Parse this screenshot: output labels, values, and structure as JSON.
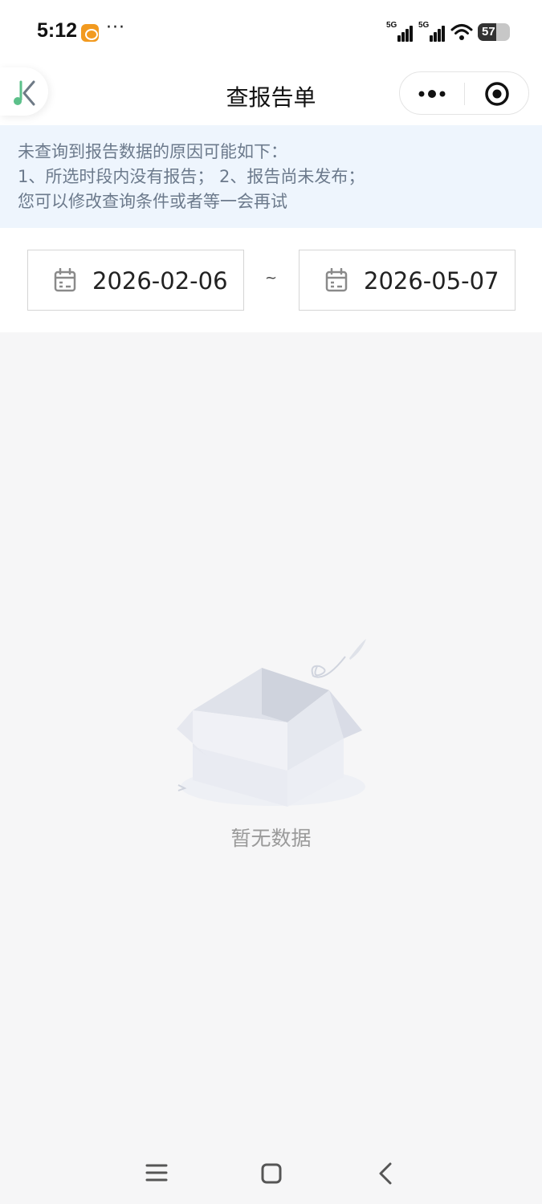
{
  "status": {
    "time": "5:12",
    "more": "···",
    "network_1": "5G",
    "network_2": "5G",
    "battery": "57"
  },
  "nav": {
    "title": "查报告单",
    "more_icon": "more-dots-icon",
    "close_icon": "target-close-icon",
    "back_icon": "back-logo-icon"
  },
  "notice": {
    "line1": "未查询到报告数据的原因可能如下：",
    "line2": "1、所选时段内没有报告； 2、报告尚未发布；",
    "line3": "您可以修改查询条件或者等一会再试"
  },
  "date_range": {
    "start": "2026-02-06",
    "separator": "~",
    "end": "2026-05-07",
    "icon": "calendar-icon"
  },
  "empty_state": {
    "text": "暂无数据",
    "icon": "empty-box-icon"
  },
  "system_nav": {
    "menu_icon": "menu-icon",
    "home_icon": "home-icon",
    "back_icon": "back-icon"
  },
  "colors": {
    "notice_bg": "#eef5fd",
    "notice_text": "#6c7a8c",
    "page_bg": "#f6f6f7",
    "logo_green": "#5cc08a"
  }
}
